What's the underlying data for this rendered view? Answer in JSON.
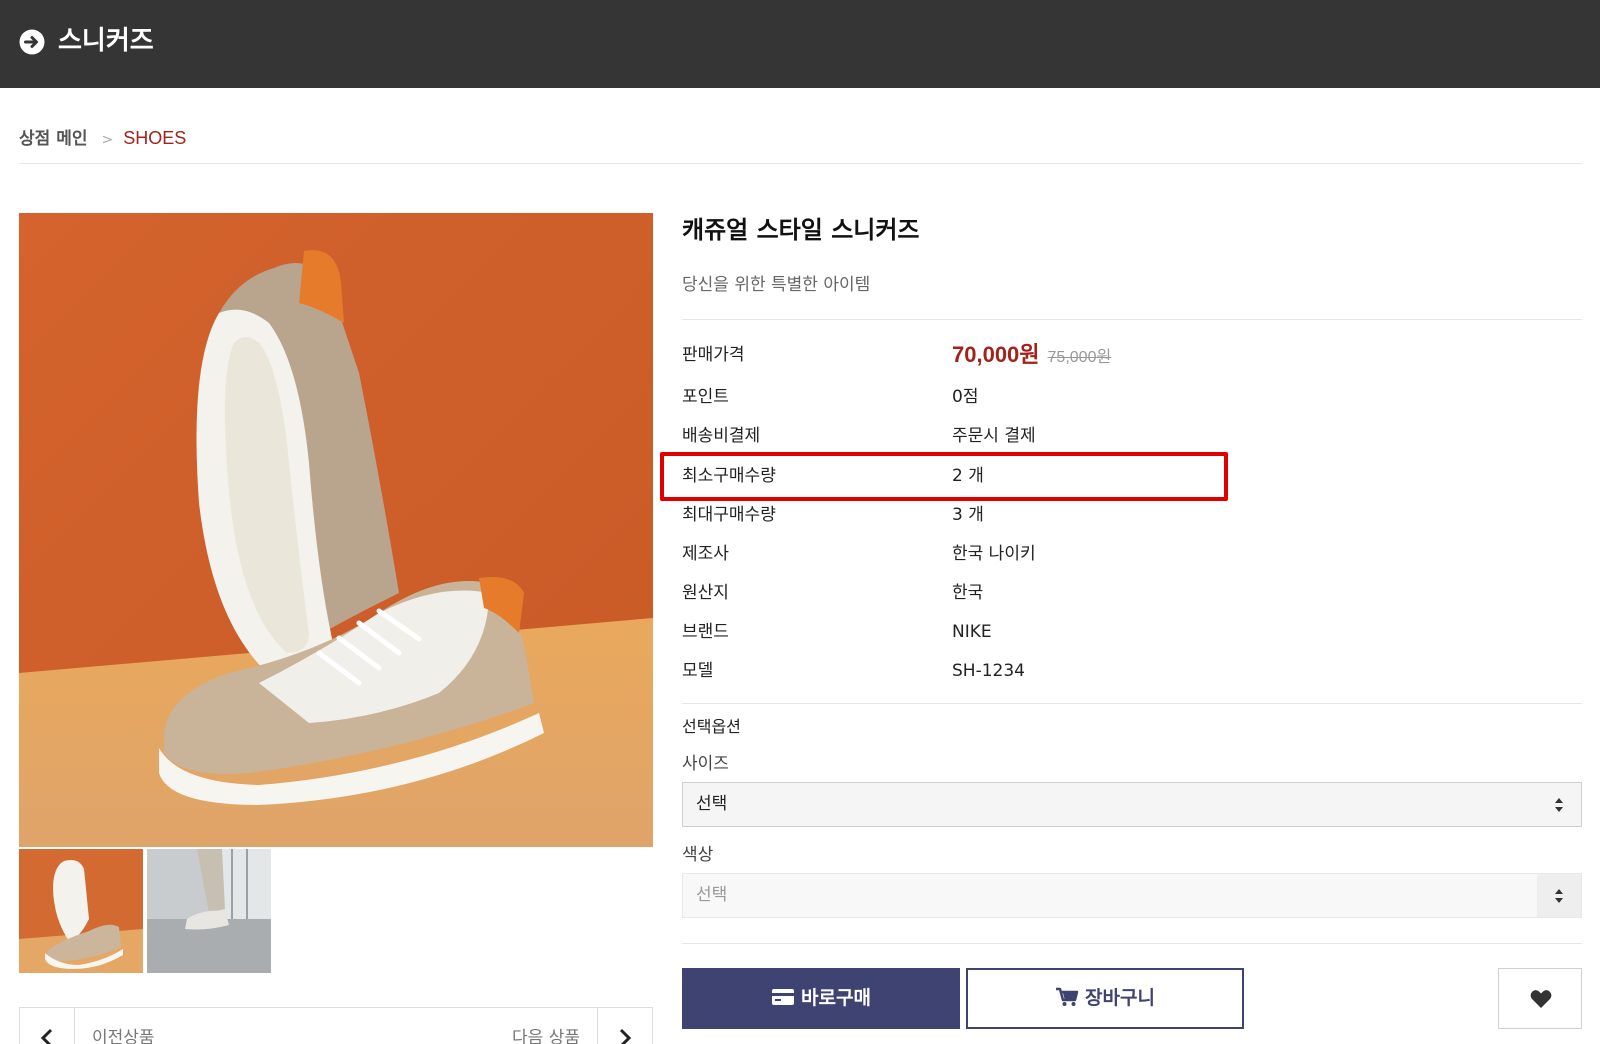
{
  "header": {
    "title": "스니커즈",
    "back_icon": "arrow-circle-right-icon"
  },
  "breadcrumb": {
    "home": "상점 메인",
    "separator": ">",
    "current": "SHOES"
  },
  "product": {
    "name": "캐쥬얼 스타일 스니커즈",
    "subtitle": "당신을 위한 특별한 아이템",
    "specs": [
      {
        "label": "판매가격",
        "sale_price": "70,000원",
        "original_price": "75,000원"
      },
      {
        "label": "포인트",
        "value": "0점"
      },
      {
        "label": "배송비결제",
        "value": "주문시 결제"
      },
      {
        "label": "최소구매수량",
        "value": "2 개"
      },
      {
        "label": "최대구매수량",
        "value": "3 개"
      },
      {
        "label": "제조사",
        "value": "한국 나이키"
      },
      {
        "label": "원산지",
        "value": "한국"
      },
      {
        "label": "브랜드",
        "value": "NIKE"
      },
      {
        "label": "모델",
        "value": "SH-1234"
      }
    ]
  },
  "options": {
    "title": "선택옵션",
    "size": {
      "label": "사이즈",
      "selected": "선택"
    },
    "color": {
      "label": "색상",
      "selected": "선택"
    }
  },
  "actions": {
    "buy": "바로구매",
    "cart": "장바구니",
    "wish_icon": "heart-icon"
  },
  "nav": {
    "prev": "이전상품",
    "next": "다음 상품"
  },
  "colors": {
    "header_bg": "#353535",
    "accent_red": "#a12319",
    "button_navy": "#3f4371",
    "highlight": "#e00000"
  }
}
